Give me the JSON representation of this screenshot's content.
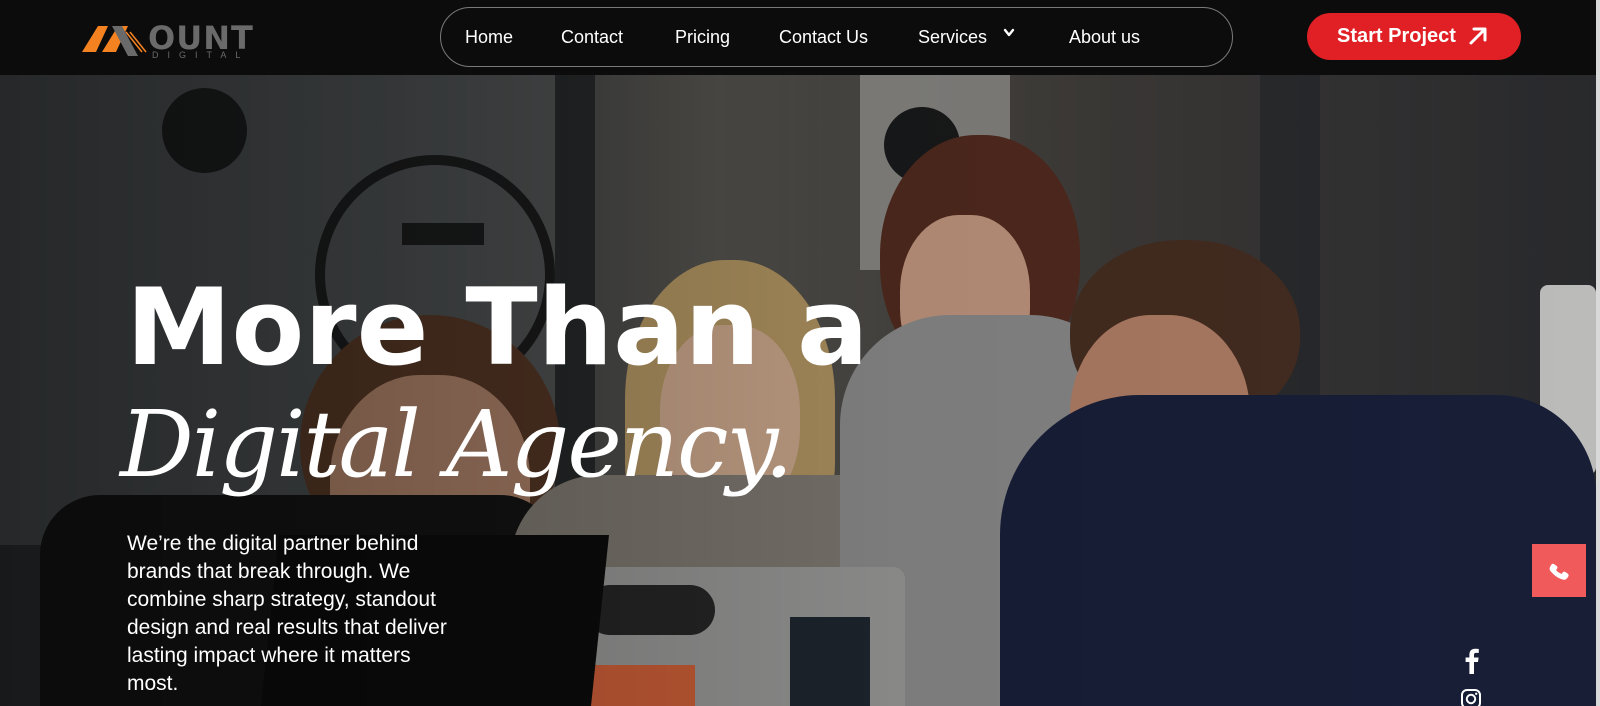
{
  "brand": {
    "name": "OUNT",
    "sub": "DIGITAL",
    "colors": {
      "orange": "#f58220",
      "gray": "#6a6a6a"
    }
  },
  "nav": {
    "items": [
      {
        "label": "Home"
      },
      {
        "label": "Contact"
      },
      {
        "label": "Pricing"
      },
      {
        "label": "Contact Us"
      },
      {
        "label": "Services",
        "icon": "chevron-down-icon"
      },
      {
        "label": "About us"
      }
    ]
  },
  "cta": {
    "label": "Start Project",
    "icon": "arrow-up-right-icon",
    "color": "#e02025"
  },
  "hero": {
    "title_line1": "More Than a",
    "title_line2": "Digital Agency.",
    "description": "We’re the digital partner behind brands that break through. We combine sharp strategy, standout design and real results that deliver lasting impact where it matters most."
  },
  "floating": {
    "phone": {
      "icon": "phone-icon",
      "color": "#f05a5a"
    },
    "social": [
      {
        "icon": "facebook-icon"
      },
      {
        "icon": "instagram-icon"
      }
    ]
  }
}
